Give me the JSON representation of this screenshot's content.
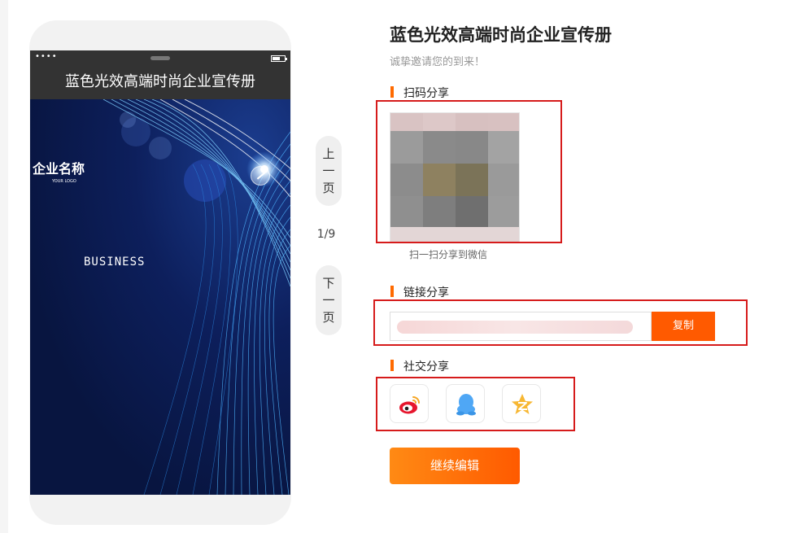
{
  "page": {
    "title": "蓝色光效高端时尚企业宣传册",
    "subtitle": "诚挚邀请您的到来！"
  },
  "phone": {
    "status_dots": "••••",
    "header_title": "蓝色光效高端时尚企业宣传册",
    "company_name": "企业名称",
    "logo_text": "YOUR LOGO",
    "business_text": "BUSINESS"
  },
  "pager": {
    "prev_chars": [
      "上",
      "一",
      "页"
    ],
    "next_chars": [
      "下",
      "一",
      "页"
    ],
    "indicator": "1/9"
  },
  "qr_share": {
    "label": "扫码分享",
    "caption": "扫一扫分享到微信"
  },
  "link_share": {
    "label": "链接分享",
    "copy_label": "复制"
  },
  "social_share": {
    "label": "社交分享",
    "items": [
      "weibo-icon",
      "qq-icon",
      "qzone-icon"
    ]
  },
  "actions": {
    "continue_label": "继续编辑"
  },
  "colors": {
    "accent": "#ff5a00",
    "highlight": "#d61b1b"
  }
}
